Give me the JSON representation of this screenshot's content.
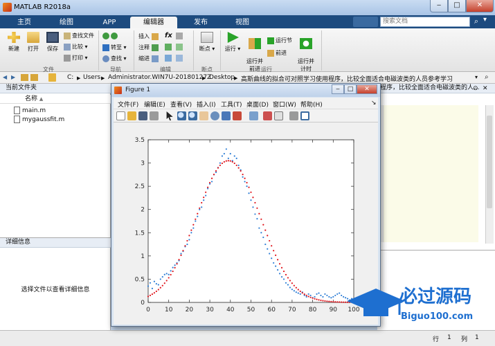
{
  "app": {
    "title": "MATLAB R2018a"
  },
  "tabs": [
    {
      "label": "主页"
    },
    {
      "label": "绘图"
    },
    {
      "label": "APP"
    },
    {
      "label": "编辑器"
    },
    {
      "label": "发布"
    },
    {
      "label": "视图"
    }
  ],
  "search": {
    "placeholder": "搜索文档"
  },
  "ribbon": {
    "file": {
      "new": "新建",
      "open": "打开",
      "save": "保存",
      "find_files": "查找文件",
      "compare": "比较",
      "print": "打印",
      "group": "文件"
    },
    "nav": {
      "goto": "转至",
      "find": "查找",
      "group": "导航"
    },
    "edit": {
      "insert": "插入",
      "comment": "注释",
      "indent": "缩进",
      "fx": "fx",
      "group": "编辑"
    },
    "breakpoints": {
      "label": "断点",
      "group": "断点"
    },
    "run": {
      "run": "运行",
      "run_advance": "运行并\n前进",
      "run_section": "运行节",
      "advance": "前进",
      "run_time": "运行并\n计时",
      "group": "运行"
    }
  },
  "address": {
    "parts": [
      "C:",
      "Users",
      "Administrator.WIN7U-20180127Z",
      "Desktop",
      "高斯曲线的拟合可对照学习使用程序，比较全面适合电磁波类的人员参考学习"
    ],
    "seps": [
      "▶",
      "▶",
      "▶",
      "▶"
    ]
  },
  "current_folder": {
    "title": "当前文件夹",
    "col_name": "名称",
    "sort_indicator": "▲",
    "files": [
      "main.m",
      "mygaussfit.m"
    ]
  },
  "details": {
    "title": "详细信息",
    "message": "选择文件以查看详细信息"
  },
  "editor_header": "程序，比较全面适合电磁波类的人...",
  "status": {
    "row_label": "行",
    "row": "1",
    "col_label": "列",
    "col": "1"
  },
  "figure": {
    "title": "Figure 1",
    "menu": [
      "文件(F)",
      "编辑(E)",
      "查看(V)",
      "插入(I)",
      "工具(T)",
      "桌面(D)",
      "窗口(W)",
      "帮助(H)"
    ]
  },
  "watermark": {
    "text": "必过源码",
    "url": "Biguo100.com"
  },
  "colors": {
    "data": "#2f7fd6",
    "fit": "#e0151c",
    "accent": "#1d4b7f"
  },
  "chart_data": {
    "type": "scatter",
    "xlim": [
      0,
      100
    ],
    "ylim": [
      0,
      3.5
    ],
    "xticks": [
      0,
      10,
      20,
      30,
      40,
      50,
      60,
      70,
      80,
      90,
      100
    ],
    "yticks": [
      0,
      0.5,
      1,
      1.5,
      2,
      2.5,
      3,
      3.5
    ],
    "grid": false,
    "series": [
      {
        "style": "dots-blue",
        "x": [
          0,
          1,
          2,
          3,
          4,
          5,
          6,
          7,
          8,
          9,
          10,
          11,
          12,
          13,
          14,
          15,
          16,
          17,
          18,
          19,
          20,
          21,
          22,
          23,
          24,
          25,
          26,
          27,
          28,
          29,
          30,
          31,
          32,
          33,
          34,
          35,
          36,
          37,
          38,
          39,
          40,
          41,
          42,
          43,
          44,
          45,
          46,
          47,
          48,
          49,
          50,
          51,
          52,
          53,
          54,
          55,
          56,
          57,
          58,
          59,
          60,
          61,
          62,
          63,
          64,
          65,
          66,
          67,
          68,
          69,
          70,
          71,
          72,
          73,
          74,
          75,
          76,
          77,
          78,
          79,
          80,
          81,
          82,
          83,
          84,
          85,
          86,
          87,
          88,
          89,
          90,
          91,
          92,
          93,
          94,
          95,
          96,
          97,
          98,
          99,
          100
        ],
        "y": [
          0.35,
          0.42,
          0.3,
          0.45,
          0.4,
          0.38,
          0.5,
          0.55,
          0.6,
          0.62,
          0.6,
          0.68,
          0.75,
          0.8,
          0.85,
          0.9,
          1.05,
          1.1,
          1.2,
          1.25,
          1.35,
          1.5,
          1.6,
          1.75,
          1.85,
          2.0,
          2.05,
          2.2,
          2.3,
          2.45,
          2.55,
          2.6,
          2.75,
          2.8,
          2.9,
          3.0,
          3.15,
          3.2,
          3.3,
          3.1,
          3.2,
          3.05,
          3.15,
          3.1,
          2.95,
          2.85,
          2.7,
          2.6,
          2.5,
          2.35,
          2.2,
          2.05,
          1.9,
          1.8,
          1.6,
          1.5,
          1.4,
          1.25,
          1.15,
          1.05,
          0.95,
          0.85,
          0.78,
          0.7,
          0.62,
          0.55,
          0.5,
          0.42,
          0.38,
          0.32,
          0.28,
          0.25,
          0.22,
          0.2,
          0.18,
          0.22,
          0.15,
          0.12,
          0.18,
          0.15,
          0.1,
          0.12,
          0.18,
          0.2,
          0.15,
          0.12,
          0.18,
          0.15,
          0.12,
          0.1,
          0.12,
          0.15,
          0.18,
          0.2,
          0.15,
          0.12,
          0.1,
          0.08,
          0.05,
          0.08,
          0.05
        ]
      },
      {
        "style": "dots-red",
        "mean": 39,
        "sigma": 15.5,
        "amplitude": 3.05,
        "x_range": [
          0,
          100
        ]
      }
    ]
  }
}
